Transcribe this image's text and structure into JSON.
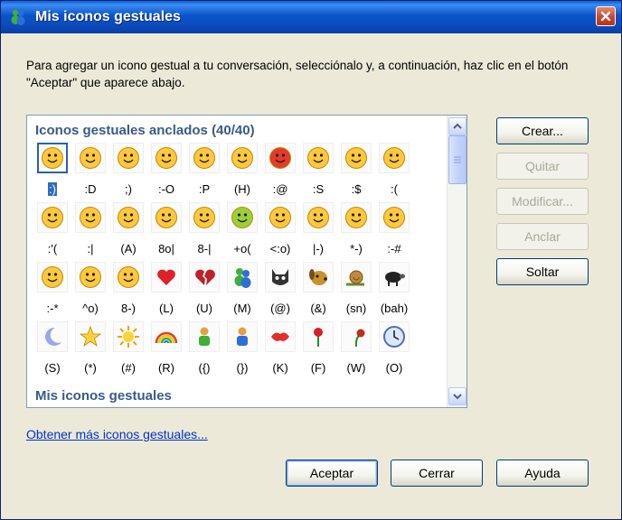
{
  "window": {
    "title": "Mis iconos gestuales"
  },
  "instructions": "Para agregar un icono gestual a tu conversación, selecciónalo y, a continuación, haz clic en el botón \"Aceptar\" que aparece abajo.",
  "list": {
    "pinned_header": "Iconos gestuales anclados (40/40)",
    "mine_header": "Mis iconos gestuales",
    "icons": [
      {
        "code": ":)",
        "icon": "smile-icon",
        "selected": true
      },
      {
        "code": ":D",
        "icon": "big-grin-icon"
      },
      {
        "code": ";)",
        "icon": "wink-icon"
      },
      {
        "code": ":-O",
        "icon": "surprised-icon"
      },
      {
        "code": ":P",
        "icon": "tongue-out-icon"
      },
      {
        "code": "(H)",
        "icon": "sunglasses-icon"
      },
      {
        "code": ":@",
        "icon": "angry-icon"
      },
      {
        "code": ":S",
        "icon": "confused-icon"
      },
      {
        "code": ":$",
        "icon": "embarrassed-icon"
      },
      {
        "code": ":(",
        "icon": "sad-icon"
      },
      {
        "code": ":'(",
        "icon": "crying-icon"
      },
      {
        "code": ":|",
        "icon": "disappointed-icon"
      },
      {
        "code": "(A)",
        "icon": "angel-icon"
      },
      {
        "code": "8o|",
        "icon": "baring-teeth-icon"
      },
      {
        "code": "8-|",
        "icon": "nerd-icon"
      },
      {
        "code": "+o(",
        "icon": "sick-icon"
      },
      {
        "code": "<:o)",
        "icon": "party-icon"
      },
      {
        "code": "|-)",
        "icon": "sleepy-icon"
      },
      {
        "code": "*-)",
        "icon": "thinking-icon"
      },
      {
        "code": ":-#",
        "icon": "dont-tell-icon"
      },
      {
        "code": ":-*",
        "icon": "secret-icon"
      },
      {
        "code": "^o)",
        "icon": "sarcastic-icon"
      },
      {
        "code": "8-)",
        "icon": "eye-rolling-icon"
      },
      {
        "code": "(L)",
        "icon": "red-heart-icon"
      },
      {
        "code": "(U)",
        "icon": "broken-heart-icon"
      },
      {
        "code": "(M)",
        "icon": "messenger-icon"
      },
      {
        "code": "(@)",
        "icon": "cat-face-icon"
      },
      {
        "code": "(&)",
        "icon": "dog-face-icon"
      },
      {
        "code": "(sn)",
        "icon": "snail-icon"
      },
      {
        "code": "(bah)",
        "icon": "black-sheep-icon"
      },
      {
        "code": "(S)",
        "icon": "moon-icon"
      },
      {
        "code": "(*)",
        "icon": "star-icon"
      },
      {
        "code": "(#)",
        "icon": "sun-icon"
      },
      {
        "code": "(R)",
        "icon": "rainbow-icon"
      },
      {
        "code": "({)",
        "icon": "left-hug-icon"
      },
      {
        "code": "(})",
        "icon": "right-hug-icon"
      },
      {
        "code": "(K)",
        "icon": "kiss-icon"
      },
      {
        "code": "(F)",
        "icon": "rose-icon"
      },
      {
        "code": "(W)",
        "icon": "wilted-rose-icon"
      },
      {
        "code": "(O)",
        "icon": "clock-icon"
      }
    ]
  },
  "side_buttons": {
    "create": "Crear...",
    "remove": "Quitar",
    "modify": "Modificar...",
    "pin": "Anclar",
    "unpin": "Soltar"
  },
  "link_text": "Obtener más iconos gestuales...",
  "footer_buttons": {
    "ok": "Aceptar",
    "close": "Cerrar",
    "help": "Ayuda"
  },
  "colors": {
    "window_bg": "#ece9d8",
    "titlebar": "#0a54c9",
    "header_text": "#3a5a8c",
    "selection": "#316ac5",
    "link": "#0033cc"
  }
}
